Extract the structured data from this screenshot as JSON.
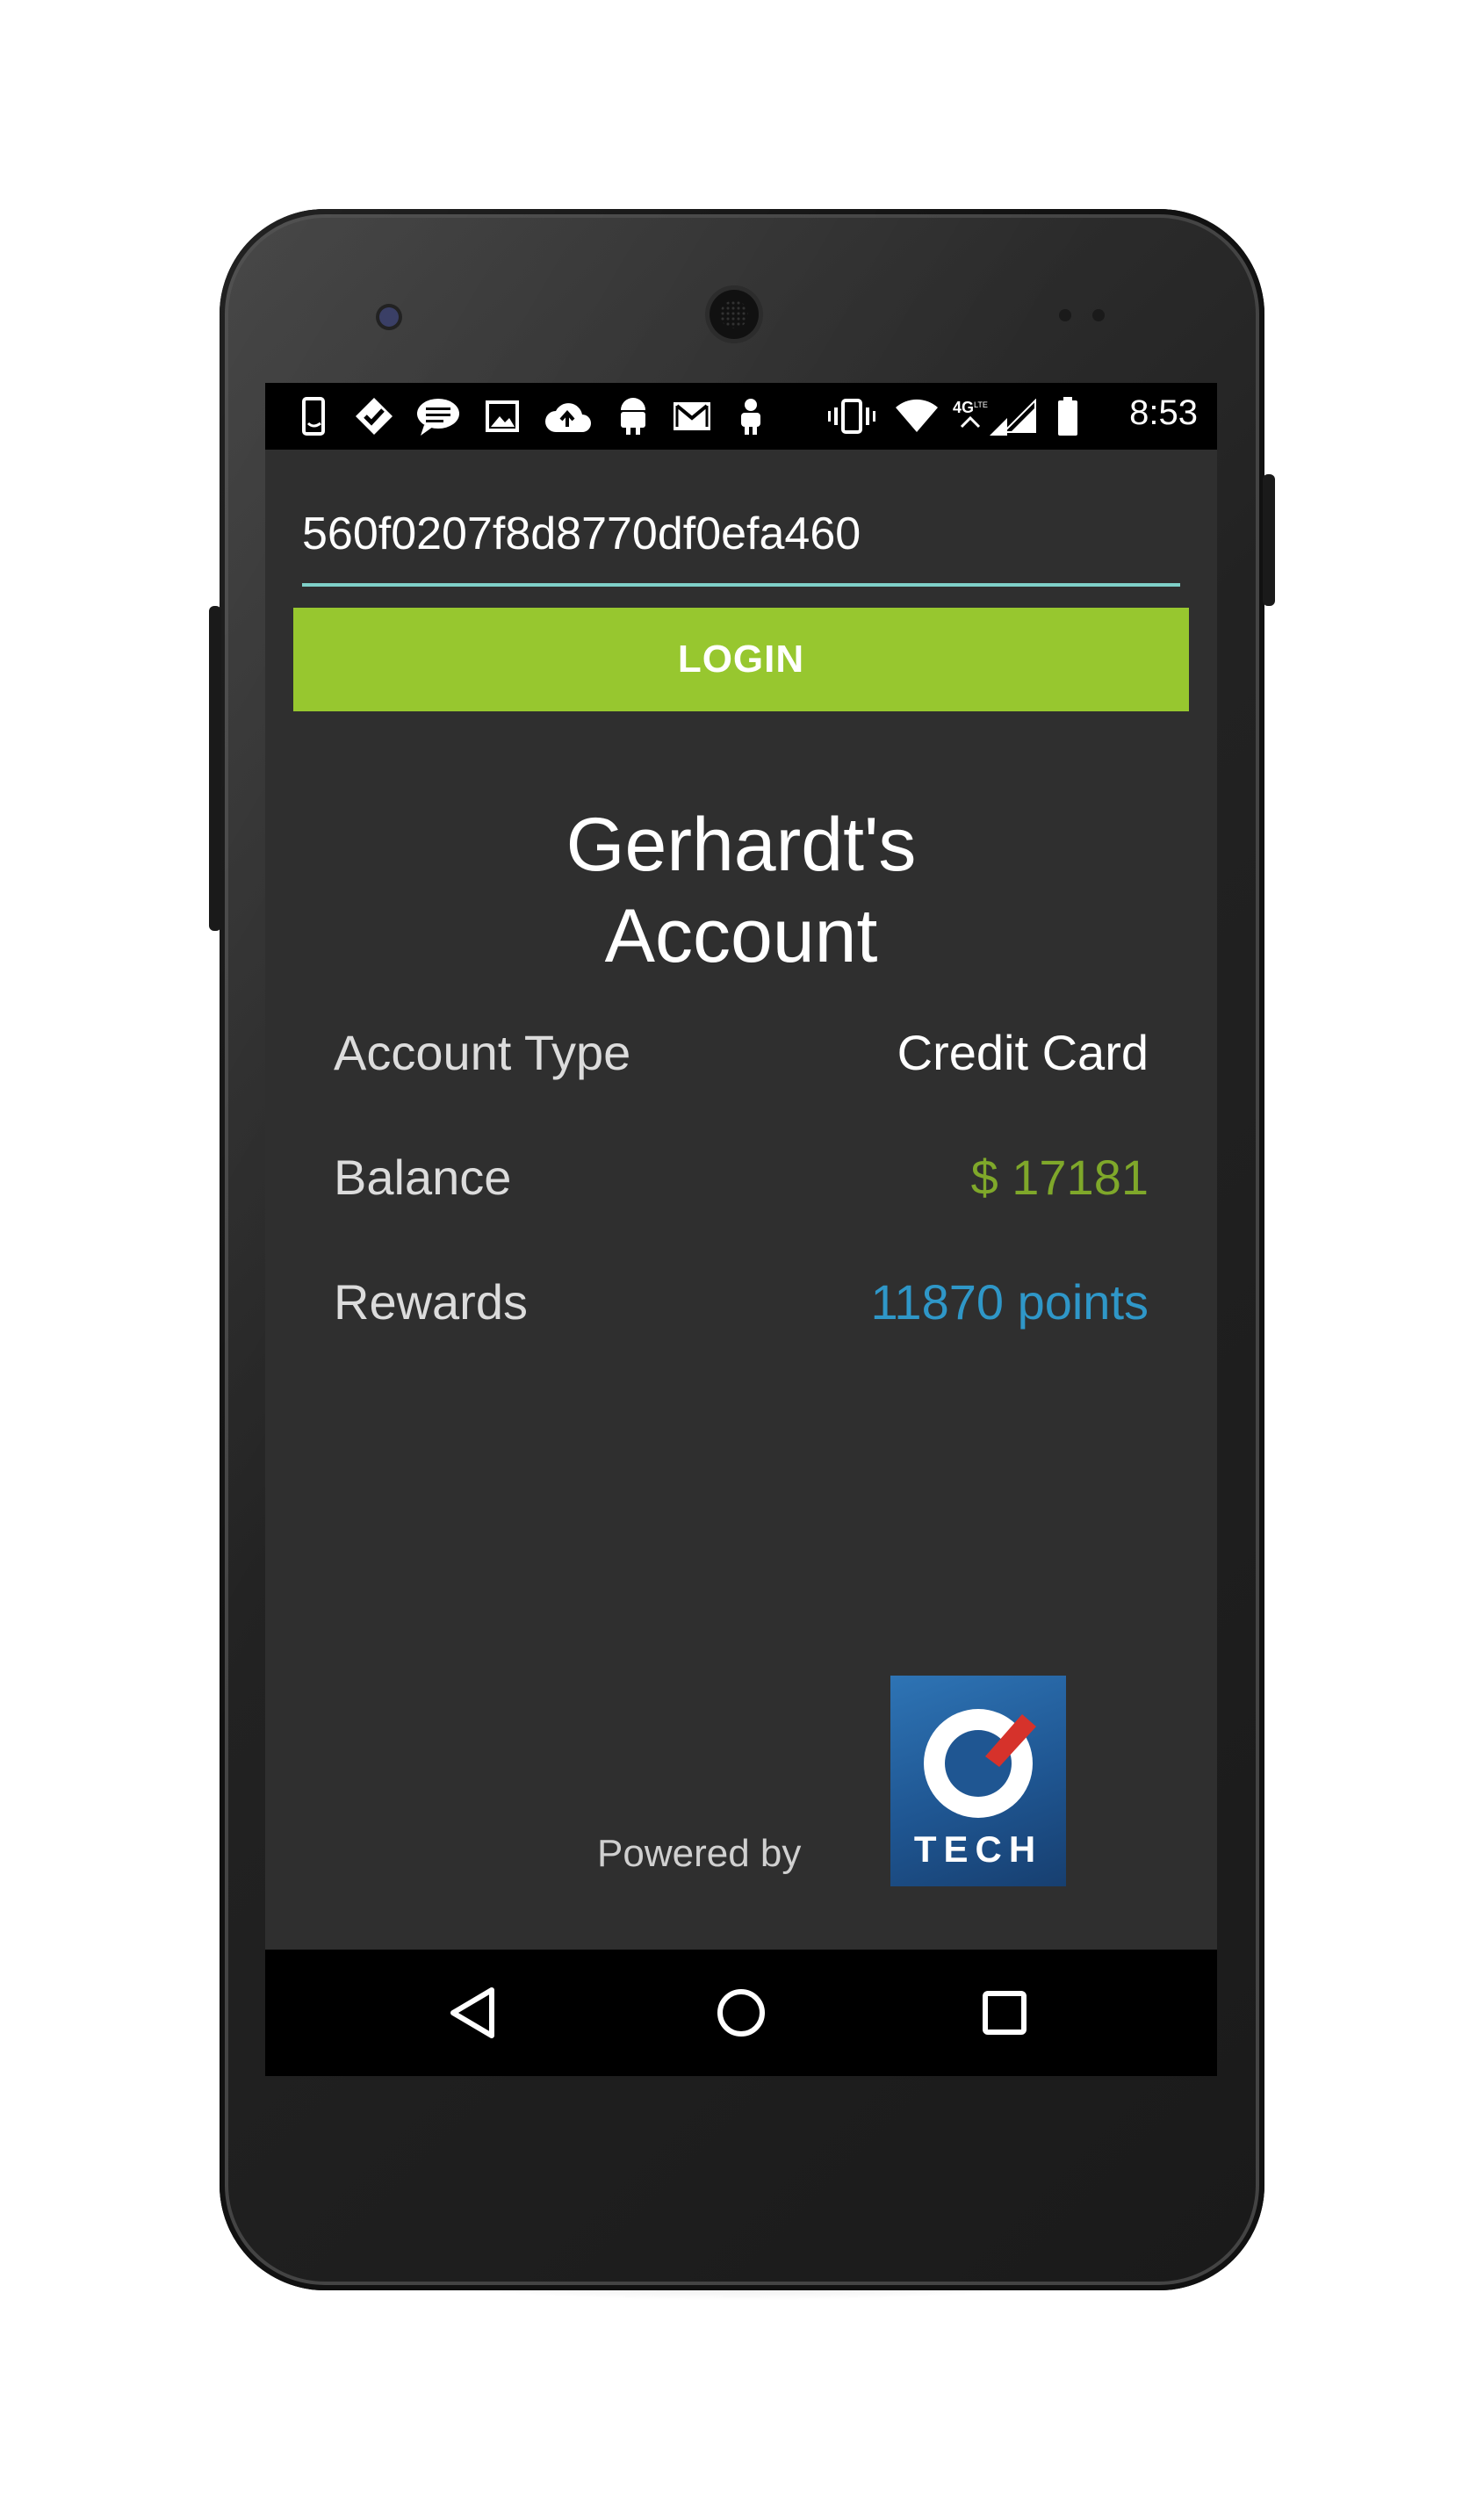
{
  "status_bar": {
    "time": "8:53",
    "left_icons": [
      "phone-sync-icon",
      "check-badge-icon",
      "chat-bubble-icon",
      "image-icon",
      "cloud-upload-icon",
      "android-icon",
      "gmail-icon",
      "person-icon"
    ],
    "right_icons": [
      "vibrate-icon",
      "wifi-icon",
      "lte-icon",
      "signal-icon",
      "battery-icon"
    ]
  },
  "login": {
    "token_value": "560f0207f8d8770df0efa460",
    "button_label": "LOGIN"
  },
  "account": {
    "title_line1": "Gerhardt's",
    "title_line2": "Account",
    "rows": [
      {
        "label": "Account Type",
        "value": "Credit Card"
      },
      {
        "label": "Balance",
        "value": "$ 17181"
      },
      {
        "label": "Rewards",
        "value": "11870 points"
      }
    ]
  },
  "footer": {
    "powered_by": "Powered by",
    "logo_text": "TECH"
  },
  "colors": {
    "accent_green": "#97c72f",
    "balance_green": "#7fa82a",
    "rewards_blue": "#2f97c8",
    "screen_bg": "#2f2f2f",
    "input_underline": "#7fd1c9"
  },
  "nav_bar": {
    "icons": [
      "back-triangle-icon",
      "home-circle-icon",
      "recents-square-icon"
    ]
  }
}
